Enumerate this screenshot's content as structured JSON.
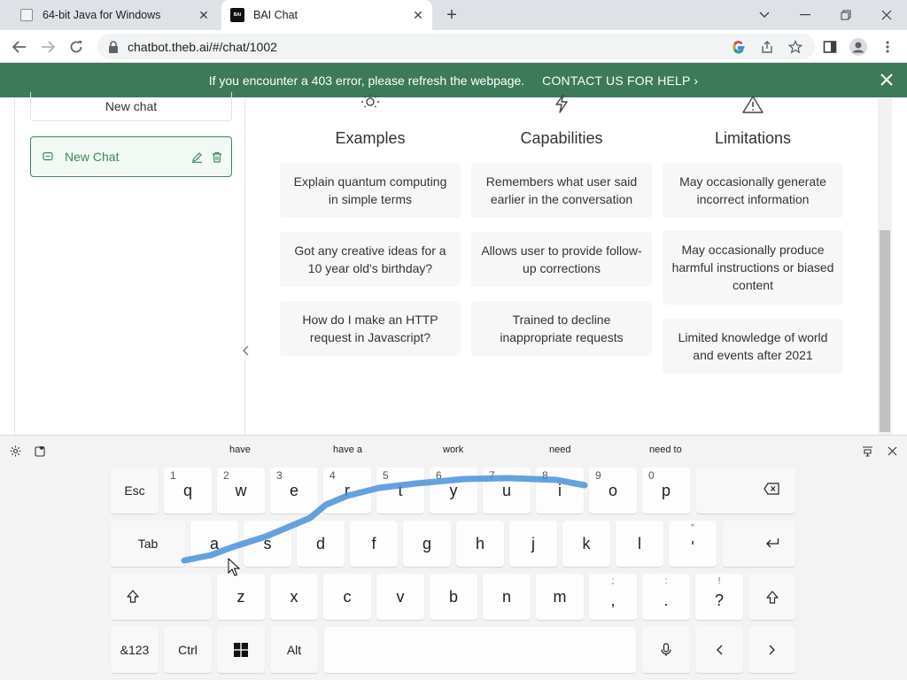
{
  "browser": {
    "tabs": [
      {
        "title": "64-bit Java for Windows",
        "active": false
      },
      {
        "title": "BAI Chat",
        "active": true,
        "favicon_text": "BAI"
      }
    ],
    "url": "chatbot.theb.ai/#/chat/1002"
  },
  "banner": {
    "message": "If you encounter a 403 error, please refresh the webpage.",
    "contact": "CONTACT US FOR HELP ›",
    "color": "#3d7a5a"
  },
  "sidebar": {
    "new_chat_label": "New chat",
    "chats": [
      {
        "label": "New Chat",
        "accent": "#3d8a5a"
      }
    ]
  },
  "main": {
    "columns": [
      {
        "heading": "Examples",
        "icon": "sun-icon",
        "cards": [
          "Explain quantum computing in simple terms",
          "Got any creative ideas for a 10 year old's birthday?",
          "How do I make an HTTP request in Javascript?"
        ]
      },
      {
        "heading": "Capabilities",
        "icon": "lightning-icon",
        "cards": [
          "Remembers what user said earlier in the conversation",
          "Allows user to provide follow-up corrections",
          "Trained to decline inappropriate requests"
        ]
      },
      {
        "heading": "Limitations",
        "icon": "warning-icon",
        "cards": [
          "May occasionally generate incorrect information",
          "May occasionally produce harmful instructions or biased content",
          "Limited knowledge of world and events after 2021"
        ]
      }
    ]
  },
  "keyboard": {
    "suggestions": [
      "have",
      "have a",
      "work",
      "need",
      "need to"
    ],
    "row1": [
      {
        "label": "Esc"
      },
      {
        "label": "q",
        "sub": "1"
      },
      {
        "label": "w",
        "sub": "2"
      },
      {
        "label": "e",
        "sub": "3"
      },
      {
        "label": "r",
        "sub": "4"
      },
      {
        "label": "t",
        "sub": "5"
      },
      {
        "label": "y",
        "sub": "6"
      },
      {
        "label": "u",
        "sub": "7"
      },
      {
        "label": "i",
        "sub": "8"
      },
      {
        "label": "o",
        "sub": "9"
      },
      {
        "label": "p",
        "sub": "0"
      }
    ],
    "row2": [
      {
        "label": "Tab"
      },
      {
        "label": "a"
      },
      {
        "label": "s"
      },
      {
        "label": "d"
      },
      {
        "label": "f"
      },
      {
        "label": "g"
      },
      {
        "label": "h"
      },
      {
        "label": "j"
      },
      {
        "label": "k"
      },
      {
        "label": "l"
      },
      {
        "label": "'",
        "top": "\""
      }
    ],
    "row3": [
      {
        "label": "z"
      },
      {
        "label": "x"
      },
      {
        "label": "c"
      },
      {
        "label": "v"
      },
      {
        "label": "b"
      },
      {
        "label": "n"
      },
      {
        "label": "m"
      },
      {
        "label": ",",
        "top": ";"
      },
      {
        "label": ".",
        "top": ":"
      },
      {
        "label": "?",
        "top": "!"
      }
    ],
    "row4": [
      {
        "label": "&123"
      },
      {
        "label": "Ctrl"
      },
      {
        "label": "Alt"
      }
    ],
    "swipe_color": "#4a90d9"
  }
}
